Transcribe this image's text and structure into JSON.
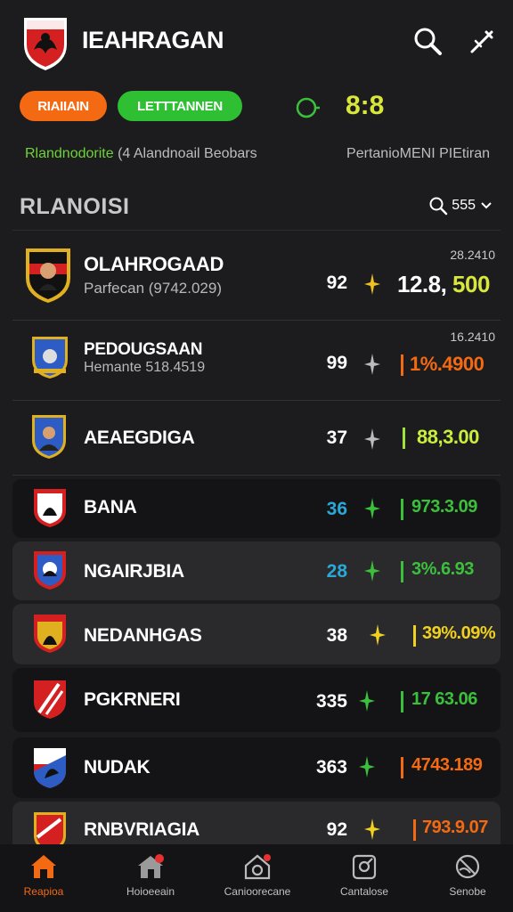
{
  "header": {
    "title": "IEAHRAGAN"
  },
  "filters": {
    "left_pill": "RIAIIAIN",
    "right_pill": "LETTTANNEN",
    "score": "8:8"
  },
  "subinfo": {
    "left_highlight": "Rlandnodorite",
    "left_rest": " (4 Alandnoail Beobars",
    "right": "PertanioMENI PIEtiran"
  },
  "section": {
    "title": "RLANOISI",
    "sort_label": "555"
  },
  "rows": [
    {
      "name": "OLAHROGAAD",
      "sub": "Parfecan (9742.029)",
      "top": "28.2410",
      "rank": "92",
      "rank_color": "#ffffff",
      "spark_color": "#f0c020",
      "bar_color": "",
      "value_a": "12.8,",
      "value_b": " 500",
      "value_color_a": "#ffffff",
      "value_color_b": "#d8e73a"
    },
    {
      "name": "PEDOUGSAAN",
      "sub": "Hemante 518.4519",
      "top": "16.2410",
      "rank": "99",
      "rank_color": "#ffffff",
      "spark_color": "#bbbbbb",
      "bar_color": "#f46a12",
      "value_a": "1%.4900",
      "value_b": "",
      "value_color_a": "#f46a12",
      "value_b_color": ""
    },
    {
      "name": "AEAEGDIGA",
      "rank": "37",
      "rank_color": "#ffffff",
      "spark_color": "#bbbbbb",
      "bar_color": "#9ee33a",
      "value_a": "88,3.00",
      "value_color_a": "#c9ef3c"
    },
    {
      "name": "BANA",
      "rank": "36",
      "rank_color": "#2aa8d8",
      "spark_color": "#3cc03c",
      "bar_color": "#3cc03c",
      "value_a": "973.3.09",
      "value_color_a": "#3cc03c"
    },
    {
      "name": "NGAIRJBIA",
      "rank": "28",
      "rank_color": "#2aa8d8",
      "spark_color": "#3cc03c",
      "bar_color": "#3cc03c",
      "value_a": "3%.6.93",
      "value_color_a": "#3cc03c"
    },
    {
      "name": "NEDANHGAS",
      "rank": "38",
      "rank_color": "#ffffff",
      "spark_color": "#f0d020",
      "bar_color": "#f0d020",
      "value_a": "39%.09%",
      "value_color_a": "#f0d020"
    },
    {
      "name": "PGKRNERI",
      "rank": "335",
      "rank_color": "#ffffff",
      "spark_color": "#3cc03c",
      "bar_color": "#3cc03c",
      "value_a": "17 63.06",
      "value_color_a": "#3cc03c"
    },
    {
      "name": "NUDAK",
      "rank": "363",
      "rank_color": "#ffffff",
      "spark_color": "#3cc03c",
      "bar_color": "#f46a12",
      "value_a": "4743.189",
      "value_color_a": "#f46a12"
    },
    {
      "name": "RNBVRIAGIA",
      "rank": "92",
      "rank_color": "#ffffff",
      "spark_color": "#f0d020",
      "bar_color": "#f46a12",
      "value_a": "793.9.07",
      "value_color_a": "#f46a12"
    }
  ],
  "nav": [
    {
      "label": "Reapioa",
      "icon": "home-icon"
    },
    {
      "label": "Hoioeeain",
      "icon": "house-badge-icon"
    },
    {
      "label": "Canioorecane",
      "icon": "camera-home-icon"
    },
    {
      "label": "Cantalose",
      "icon": "phone-icon"
    },
    {
      "label": "Senobe",
      "icon": "ball-icon"
    }
  ],
  "colors": {
    "accent": "#f46a12",
    "green": "#2fbf33",
    "lime": "#d8e73a",
    "bg": "#1c1c1e"
  }
}
